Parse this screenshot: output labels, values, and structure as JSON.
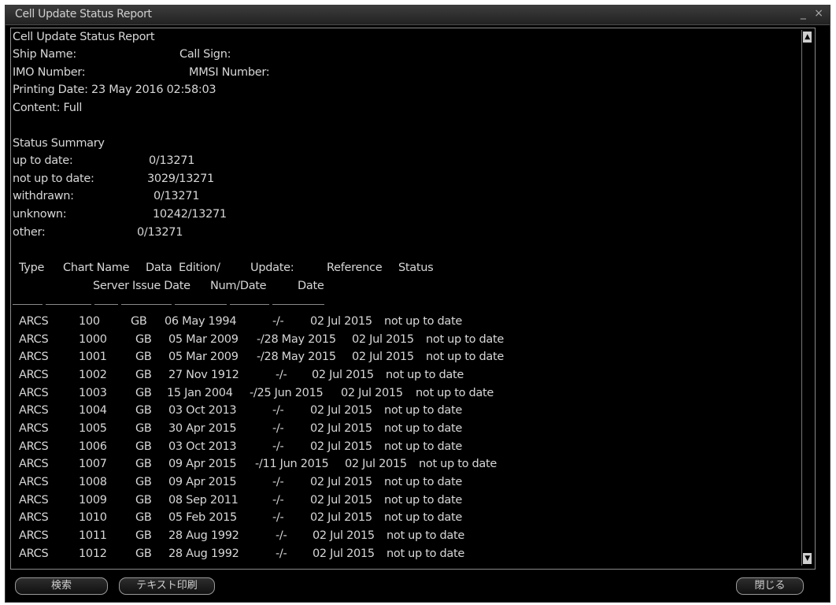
{
  "window": {
    "title": "Cell Update Status Report",
    "controls": [
      "_",
      "×"
    ]
  },
  "report": {
    "heading": "Cell Update Status Report",
    "ship_name_label": "Ship Name:",
    "call_sign_label": "Call Sign:",
    "imo_label": "IMO Number:",
    "mmsi_label": "MMSI Number:",
    "printing_date": "Printing Date: 23 May 2016 02:58:03",
    "content": "Content: Full",
    "status_summary_title": "Status Summary",
    "summary": [
      {
        "label": "up to date:",
        "value": "0/13271"
      },
      {
        "label": "not up to date:",
        "value": "3029/13271"
      },
      {
        "label": "withdrawn:",
        "value": "0/13271"
      },
      {
        "label": "unknown:",
        "value": "10242/13271"
      },
      {
        "label": "other:",
        "value": "0/13271"
      }
    ],
    "table_header": {
      "line1": {
        "type": "Type",
        "chart_name": "Chart Name",
        "data": "Data",
        "edition": "Edition/",
        "update": "Update:",
        "reference": "Reference",
        "status": "Status"
      },
      "line2": {
        "server": "Server",
        "issue_date": "Issue Date",
        "num_date": "Num/Date",
        "date": "Date"
      }
    },
    "rows": [
      {
        "type": "ARCS",
        "chart": "100",
        "server": "GB",
        "edition": "06 May 1994",
        "update": "-/-",
        "reference": "02 Jul 2015",
        "status": "not up to date"
      },
      {
        "type": "ARCS",
        "chart": "1000",
        "server": "GB",
        "edition": "05 Mar 2009",
        "update": "-/28 May 2015",
        "reference": "02 Jul 2015",
        "status": "not up to date"
      },
      {
        "type": "ARCS",
        "chart": "1001",
        "server": "GB",
        "edition": "05 Mar 2009",
        "update": "-/28 May 2015",
        "reference": "02 Jul 2015",
        "status": "not up to date"
      },
      {
        "type": "ARCS",
        "chart": "1002",
        "server": "GB",
        "edition": "27 Nov 1912",
        "update": "-/-",
        "reference": "02 Jul 2015",
        "status": "not up to date"
      },
      {
        "type": "ARCS",
        "chart": "1003",
        "server": "GB",
        "edition": "15 Jan 2004",
        "update": "-/25 Jun 2015",
        "reference": "02 Jul 2015",
        "status": "not up to date"
      },
      {
        "type": "ARCS",
        "chart": "1004",
        "server": "GB",
        "edition": "03 Oct 2013",
        "update": "-/-",
        "reference": "02 Jul 2015",
        "status": "not up to date"
      },
      {
        "type": "ARCS",
        "chart": "1005",
        "server": "GB",
        "edition": "30 Apr 2015",
        "update": "-/-",
        "reference": "02 Jul 2015",
        "status": "not up to date"
      },
      {
        "type": "ARCS",
        "chart": "1006",
        "server": "GB",
        "edition": "03 Oct 2013",
        "update": "-/-",
        "reference": "02 Jul 2015",
        "status": "not up to date"
      },
      {
        "type": "ARCS",
        "chart": "1007",
        "server": "GB",
        "edition": "09 Apr 2015",
        "update": "-/11 Jun 2015",
        "reference": "02 Jul 2015",
        "status": "not up to date"
      },
      {
        "type": "ARCS",
        "chart": "1008",
        "server": "GB",
        "edition": "09 Apr 2015",
        "update": "-/-",
        "reference": "02 Jul 2015",
        "status": "not up to date"
      },
      {
        "type": "ARCS",
        "chart": "1009",
        "server": "GB",
        "edition": "08 Sep 2011",
        "update": "-/-",
        "reference": "02 Jul 2015",
        "status": "not up to date"
      },
      {
        "type": "ARCS",
        "chart": "1010",
        "server": "GB",
        "edition": "05 Feb 2015",
        "update": "-/-",
        "reference": "02 Jul 2015",
        "status": "not up to date"
      },
      {
        "type": "ARCS",
        "chart": "1011",
        "server": "GB",
        "edition": "28 Aug 1992",
        "update": "-/-",
        "reference": "02 Jul 2015",
        "status": "not up to date"
      },
      {
        "type": "ARCS",
        "chart": "1012",
        "server": "GB",
        "edition": "28 Aug 1992",
        "update": "-/-",
        "reference": "02 Jul 2015",
        "status": "not up to date"
      }
    ]
  },
  "buttons": {
    "search": "検索",
    "print_text": "テキスト印刷",
    "close": "閉じる"
  }
}
